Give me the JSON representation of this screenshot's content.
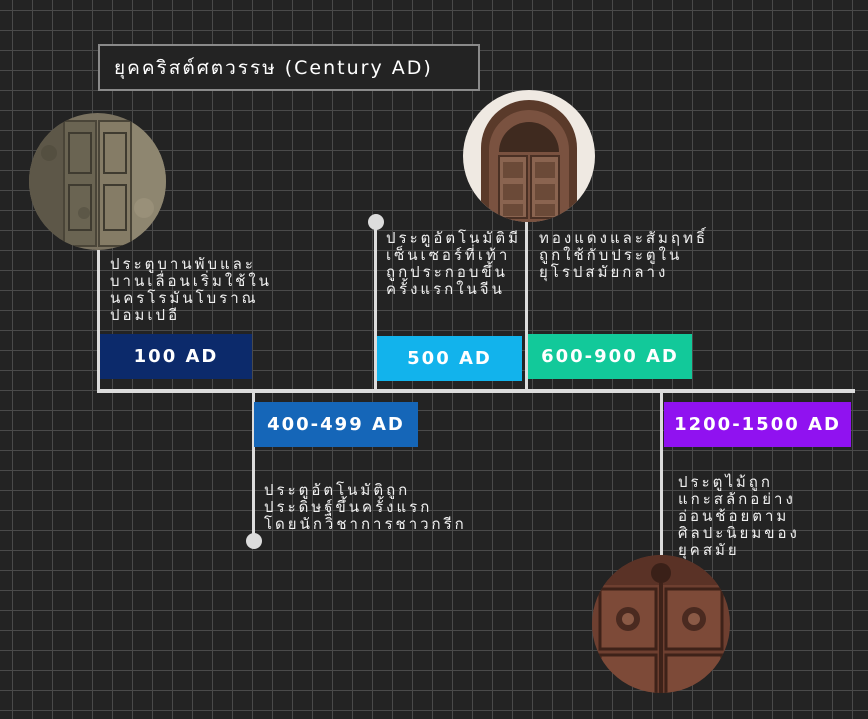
{
  "title": "ยุคคริสต์ศตวรรษ (Century AD)",
  "events": [
    {
      "label": "100 AD",
      "color": "#0c2a6b",
      "desc": [
        "ประตูบานพับและ",
        "บานเลื่อนเริ่มใช้ใน",
        "นครโรมันโบราณ",
        "ปอมเปอี"
      ]
    },
    {
      "label": "400-499 AD",
      "color": "#1566b8",
      "desc": [
        "ประตูอัตโนมัติถูก",
        "ประดิษฐ์ขึ้นครั้งแรก",
        "โดยนักวิชาการชาวกรีก"
      ]
    },
    {
      "label": "500 AD",
      "color": "#12b3ec",
      "desc": [
        "ประตูอัตโนมัติมี",
        "เซ็นเซอร์ที่เท้า",
        "ถูกประกอบขึ้น",
        "ครั้งแรกในจีน"
      ]
    },
    {
      "label": "600-900 AD",
      "color": "#12c99a",
      "desc": [
        "ทองแดงและสัมฤทธิ์",
        "ถูกใช้กับประตูใน",
        "ยุโรปสมัยกลาง"
      ]
    },
    {
      "label": "1200-1500 AD",
      "color": "#9012f0",
      "desc": [
        "ประตูไม้ถูก",
        "แกะสลักอย่าง",
        "อ่อนช้อยตาม",
        "ศิลปะนิยมของ",
        "ยุคสมัย"
      ]
    }
  ]
}
